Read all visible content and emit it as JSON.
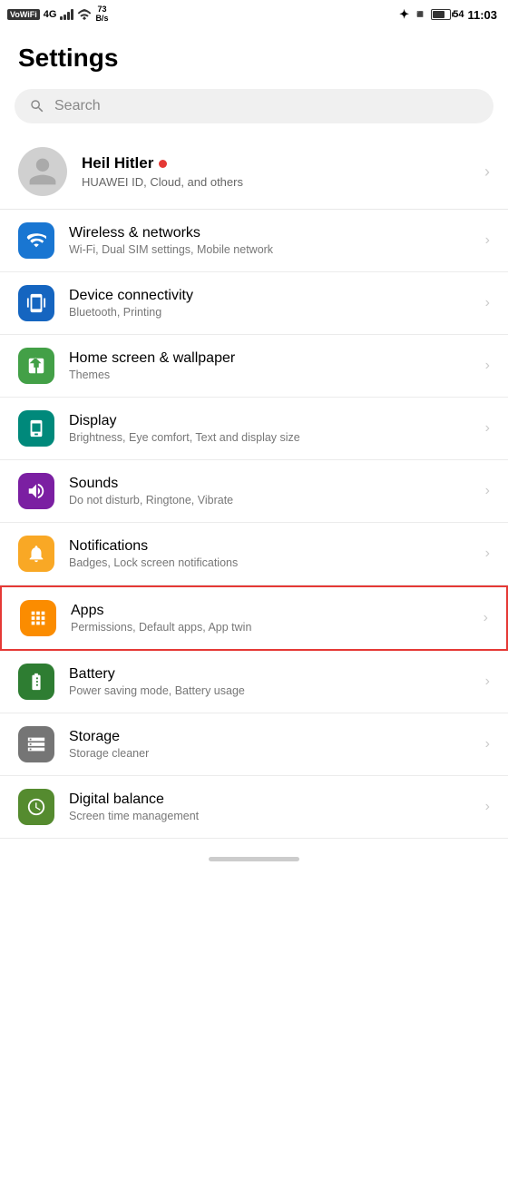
{
  "statusBar": {
    "vowifi": "VoWiFi",
    "signal": "4G",
    "speed": "73\nB/s",
    "batteryPercent": "54",
    "time": "11:03"
  },
  "page": {
    "title": "Settings"
  },
  "search": {
    "placeholder": "Search"
  },
  "profile": {
    "name": "Heil Hitler",
    "subtitle": "HUAWEI ID, Cloud, and others"
  },
  "settingsItems": [
    {
      "id": "wireless",
      "title": "Wireless & networks",
      "subtitle": "Wi-Fi, Dual SIM settings, Mobile network",
      "iconColor": "icon-blue",
      "iconType": "wifi",
      "highlighted": false
    },
    {
      "id": "device-connectivity",
      "title": "Device connectivity",
      "subtitle": "Bluetooth, Printing",
      "iconColor": "icon-blue2",
      "iconType": "device",
      "highlighted": false
    },
    {
      "id": "home-screen",
      "title": "Home screen & wallpaper",
      "subtitle": "Themes",
      "iconColor": "icon-green-light",
      "iconType": "home",
      "highlighted": false
    },
    {
      "id": "display",
      "title": "Display",
      "subtitle": "Brightness, Eye comfort, Text and display size",
      "iconColor": "icon-teal",
      "iconType": "display",
      "highlighted": false
    },
    {
      "id": "sounds",
      "title": "Sounds",
      "subtitle": "Do not disturb, Ringtone, Vibrate",
      "iconColor": "icon-purple",
      "iconType": "sound",
      "highlighted": false
    },
    {
      "id": "notifications",
      "title": "Notifications",
      "subtitle": "Badges, Lock screen notifications",
      "iconColor": "icon-amber",
      "iconType": "notification",
      "highlighted": false
    },
    {
      "id": "apps",
      "title": "Apps",
      "subtitle": "Permissions, Default apps, App twin",
      "iconColor": "icon-orange",
      "iconType": "apps",
      "highlighted": true
    },
    {
      "id": "battery",
      "title": "Battery",
      "subtitle": "Power saving mode, Battery usage",
      "iconColor": "icon-green",
      "iconType": "battery",
      "highlighted": false
    },
    {
      "id": "storage",
      "title": "Storage",
      "subtitle": "Storage cleaner",
      "iconColor": "icon-grey",
      "iconType": "storage",
      "highlighted": false
    },
    {
      "id": "digital-balance",
      "title": "Digital balance",
      "subtitle": "Screen time management",
      "iconColor": "icon-green2",
      "iconType": "digital",
      "highlighted": false
    }
  ]
}
